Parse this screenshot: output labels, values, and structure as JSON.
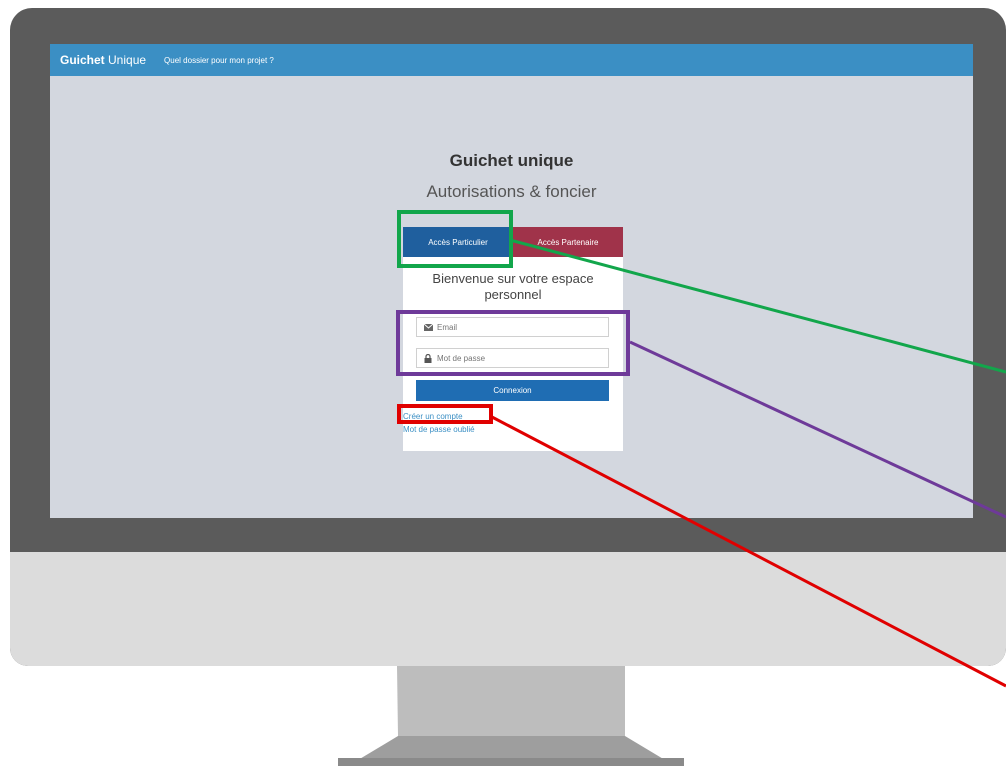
{
  "navbar": {
    "brand_bold": "Guichet",
    "brand_rest": "Unique",
    "link": "Quel dossier pour mon projet ?"
  },
  "page": {
    "title": "Guichet unique",
    "subtitle": "Autorisations & foncier"
  },
  "tabs": {
    "particulier": "Accès Particulier",
    "partenaire": "Accès Partenaire"
  },
  "card": {
    "welcome": "Bienvenue sur votre espace personnel",
    "email_placeholder": "Email",
    "password_placeholder": "Mot de passe",
    "login_button": "Connexion",
    "create_account": "Créer un compte",
    "forgot_password": "Mot de passe oublié"
  },
  "colors": {
    "navbar": "#3b8fc4",
    "tab_particulier": "#1f5f9e",
    "tab_partenaire": "#a0334a",
    "button": "#1f6db3",
    "highlight_green": "#12a64b",
    "highlight_purple": "#6e3a99",
    "highlight_red": "#e00000"
  },
  "icons": {
    "email": "envelope-icon",
    "password": "lock-icon"
  }
}
